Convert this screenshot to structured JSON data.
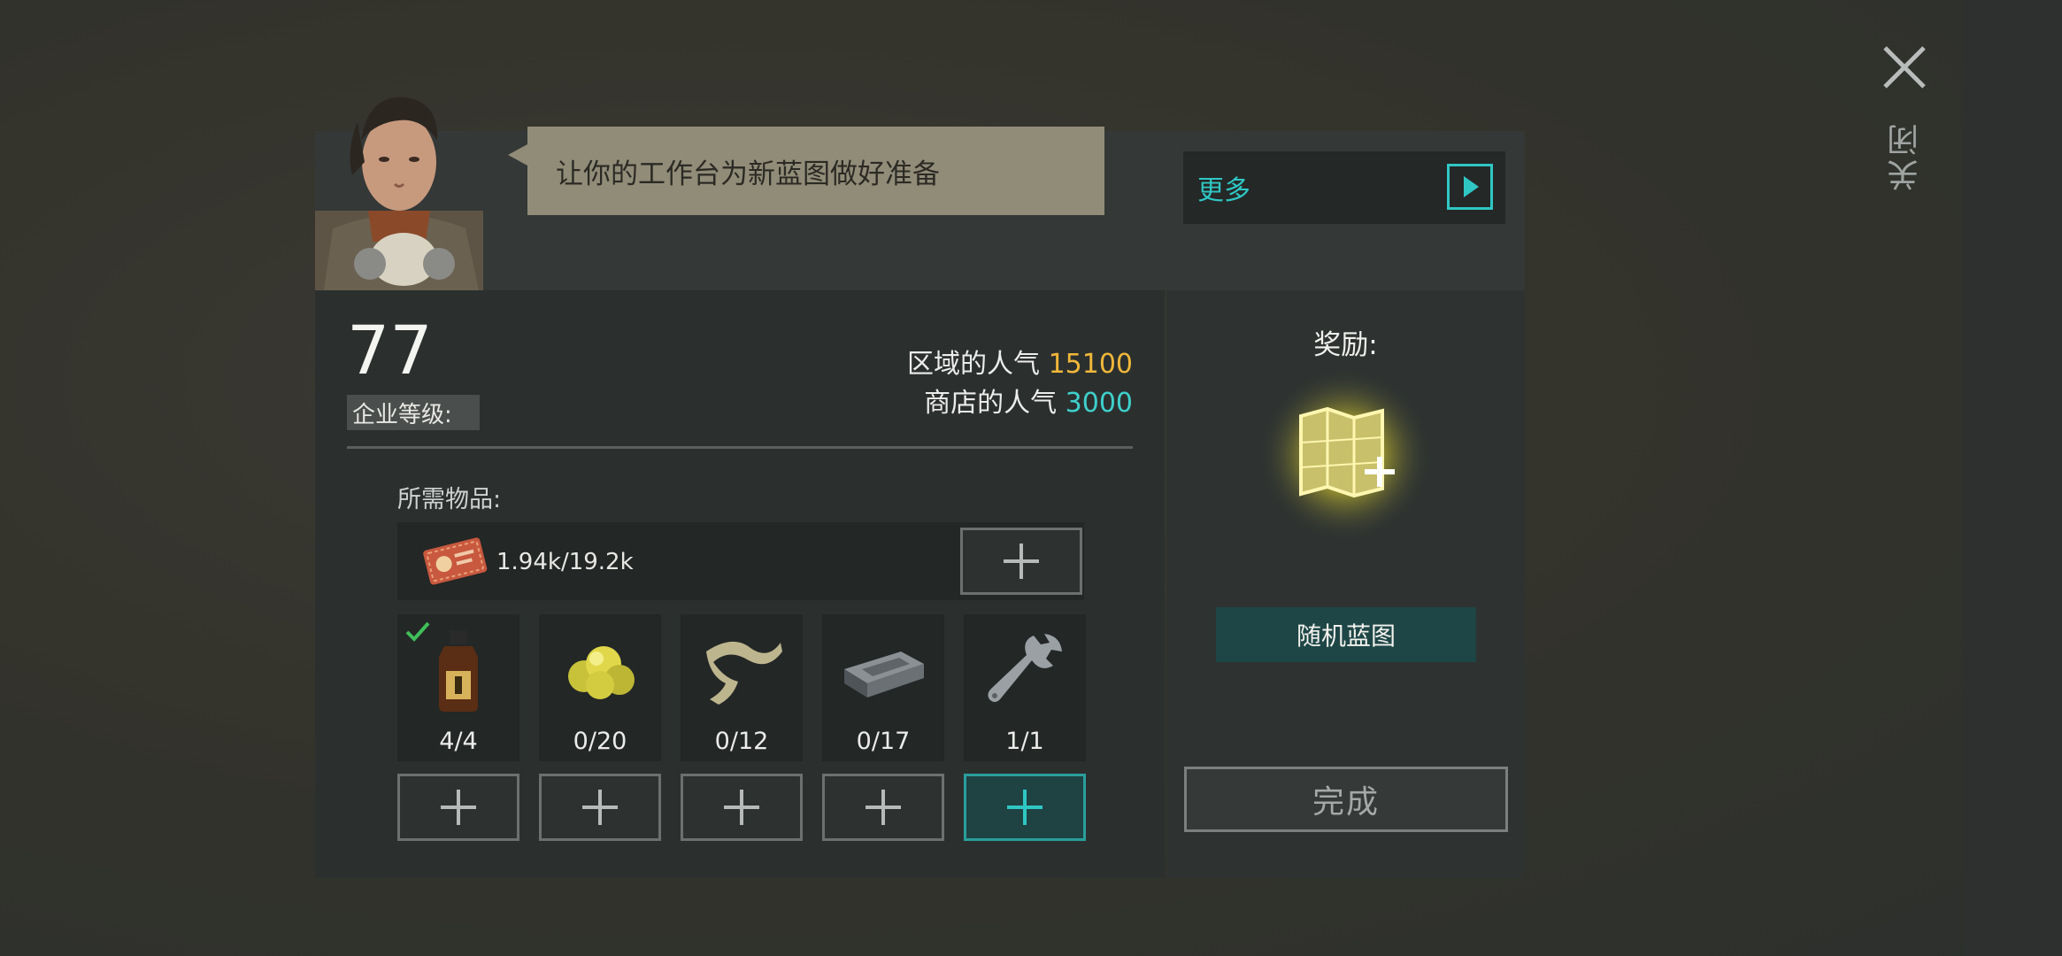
{
  "dialog": {
    "close_label": "关闭",
    "speech_text": "让你的工作台为新蓝图做好准备",
    "more_label": "更多"
  },
  "level": {
    "value": "77",
    "label": "企业等级:"
  },
  "popularity": {
    "area_label": "区域的人气",
    "area_value": "15100",
    "shop_label": "商店的人气",
    "shop_value": "3000"
  },
  "requirements": {
    "label": "所需物品:",
    "coupon": {
      "icon": "coupon-ticket-icon",
      "amount": "1.94k/19.2k"
    },
    "items": [
      {
        "icon": "oil-bottle-icon",
        "count": "4/4",
        "complete": true
      },
      {
        "icon": "sulfur-ore-icon",
        "count": "0/20",
        "complete": false
      },
      {
        "icon": "cloth-strip-icon",
        "count": "0/12",
        "complete": false
      },
      {
        "icon": "metal-ingot-icon",
        "count": "0/17",
        "complete": false
      },
      {
        "icon": "wrench-icon",
        "count": "1/1",
        "complete": false
      }
    ]
  },
  "reward": {
    "label": "奖励:",
    "icon": "blueprint-map-icon",
    "name": "随机蓝图"
  },
  "actions": {
    "done_label": "完成"
  },
  "colors": {
    "accent_cyan": "#2fc7c4",
    "gold": "#f1b73a",
    "speech_bg": "#918c78"
  }
}
